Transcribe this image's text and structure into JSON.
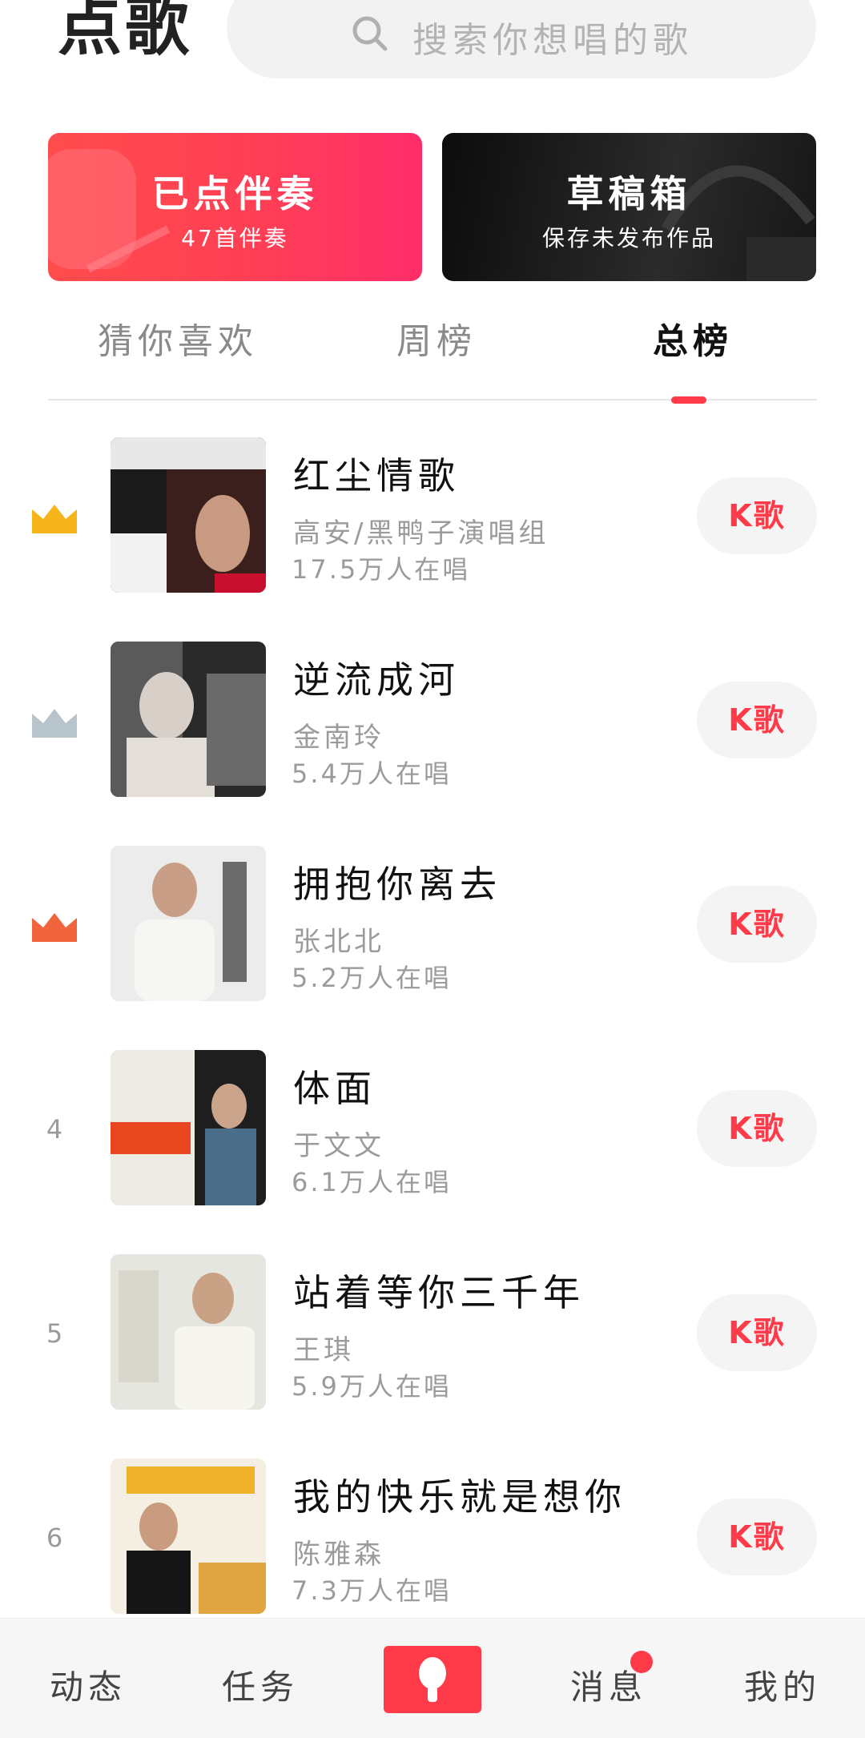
{
  "header": {
    "title": "点歌",
    "search_placeholder": "搜索你想唱的歌"
  },
  "cards": [
    {
      "title": "已点伴奏",
      "subtitle": "47首伴奏"
    },
    {
      "title": "草稿箱",
      "subtitle": "保存未发布作品"
    }
  ],
  "tabs": [
    {
      "label": "猜你喜欢",
      "active": false
    },
    {
      "label": "周榜",
      "active": false
    },
    {
      "label": "总榜",
      "active": true
    }
  ],
  "colors": {
    "accent": "#ff3b4a",
    "gold": "#f7b51c",
    "silver": "#b7c4cc",
    "bronze": "#f0653c"
  },
  "songs": [
    {
      "rank": "1",
      "rank_icon": "crown-gold-icon",
      "title": "红尘情歌",
      "artist": "高安/黑鸭子演唱组",
      "count": "17.5万人在唱",
      "button": "K歌"
    },
    {
      "rank": "2",
      "rank_icon": "crown-silver-icon",
      "title": "逆流成河",
      "artist": "金南玲",
      "count": "5.4万人在唱",
      "button": "K歌"
    },
    {
      "rank": "3",
      "rank_icon": "crown-bronze-icon",
      "title": "拥抱你离去",
      "artist": "张北北",
      "count": "5.2万人在唱",
      "button": "K歌"
    },
    {
      "rank": "4",
      "title": "体面",
      "artist": "于文文",
      "count": "6.1万人在唱",
      "button": "K歌"
    },
    {
      "rank": "5",
      "title": "站着等你三千年",
      "artist": "王琪",
      "count": "5.9万人在唱",
      "button": "K歌"
    },
    {
      "rank": "6",
      "title": "我的快乐就是想你",
      "artist": "陈雅森",
      "count": "7.3万人在唱",
      "button": "K歌"
    }
  ],
  "nav": [
    {
      "label": "动态"
    },
    {
      "label": "任务"
    },
    {
      "icon": "bulb-icon"
    },
    {
      "label": "消息"
    },
    {
      "label": "我的"
    }
  ]
}
